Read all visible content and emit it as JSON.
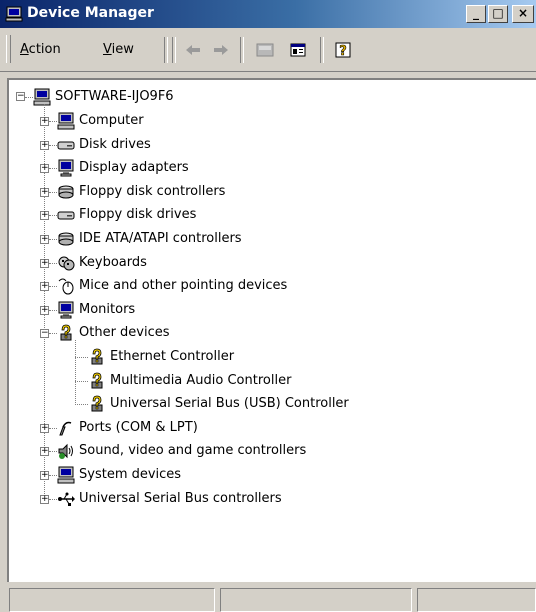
{
  "window": {
    "title": "Device Manager",
    "controls": {
      "minimize": "_",
      "maximize": "□",
      "close": "×"
    }
  },
  "toolbar": {
    "menus": [
      {
        "label": "Action",
        "accel": "A",
        "rest": "ction"
      },
      {
        "label": "View",
        "accel": "V",
        "rest": "iew"
      }
    ],
    "buttons": [
      "back-arrow-icon",
      "forward-arrow-icon",
      "up-level-icon",
      "properties-icon",
      "help-icon"
    ]
  },
  "tree": {
    "root": {
      "label": "SOFTWARE-IJO9F6",
      "icon": "computer-icon",
      "expanded": true
    },
    "categories": [
      {
        "label": "Computer",
        "icon": "computer-icon",
        "expanded": false
      },
      {
        "label": "Disk drives",
        "icon": "disk-drive-icon",
        "expanded": false
      },
      {
        "label": "Display adapters",
        "icon": "display-adapter-icon",
        "expanded": false
      },
      {
        "label": "Floppy disk controllers",
        "icon": "floppy-controller-icon",
        "expanded": false
      },
      {
        "label": "Floppy disk drives",
        "icon": "floppy-drive-icon",
        "expanded": false
      },
      {
        "label": "IDE ATA/ATAPI controllers",
        "icon": "ide-controller-icon",
        "expanded": false
      },
      {
        "label": "Keyboards",
        "icon": "keyboard-icon",
        "expanded": false
      },
      {
        "label": "Mice and other pointing devices",
        "icon": "mouse-icon",
        "expanded": false
      },
      {
        "label": "Monitors",
        "icon": "monitor-icon",
        "expanded": false
      },
      {
        "label": "Other devices",
        "icon": "unknown-device-icon",
        "expanded": true,
        "children": [
          {
            "label": "Ethernet Controller",
            "icon": "unknown-device-icon"
          },
          {
            "label": "Multimedia Audio Controller",
            "icon": "unknown-device-icon"
          },
          {
            "label": "Universal Serial Bus (USB) Controller",
            "icon": "unknown-device-icon"
          }
        ]
      },
      {
        "label": "Ports (COM & LPT)",
        "icon": "port-icon",
        "expanded": false
      },
      {
        "label": "Sound, video and game controllers",
        "icon": "sound-icon",
        "expanded": false
      },
      {
        "label": "System devices",
        "icon": "system-devices-icon",
        "expanded": false
      },
      {
        "label": "Universal Serial Bus controllers",
        "icon": "usb-icon",
        "expanded": false
      }
    ]
  },
  "colors": {
    "titlebar_start": "#0a246a",
    "titlebar_end": "#a6caf0",
    "face": "#d4d0c8",
    "unknown_device_yellow": "#f5d000"
  }
}
